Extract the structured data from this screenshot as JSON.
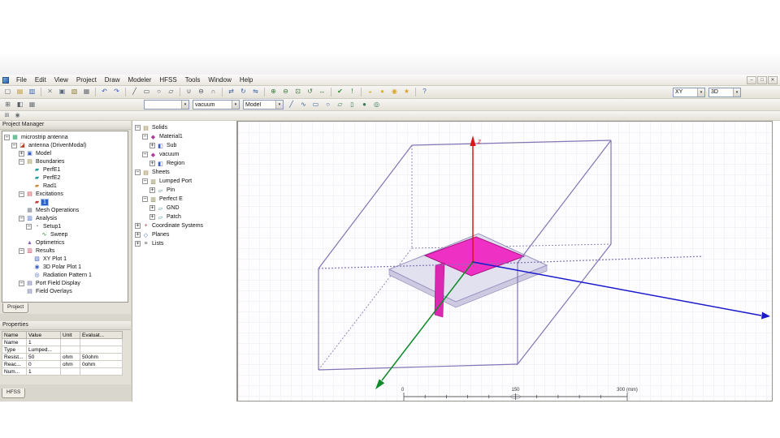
{
  "colors": {
    "selection": "#2b5fc7",
    "patch": "#ee30c5",
    "substrate": "#dfdeee",
    "box_edge": "#8474b4",
    "axis_x": "#1a1acc",
    "axis_y": "#0f8a28",
    "axis_z": "#e01414"
  },
  "app": {
    "menu_items": [
      "File",
      "Edit",
      "View",
      "Project",
      "Draw",
      "Modeler",
      "HFSS",
      "Tools",
      "Window",
      "Help"
    ],
    "window_controls": [
      {
        "n": "minimize-icon",
        "g": "–"
      },
      {
        "n": "restore-icon",
        "g": "□"
      },
      {
        "n": "close-icon",
        "g": "✕"
      }
    ]
  },
  "toolbars": {
    "combos": {
      "part": "",
      "material": "vacuum",
      "model": "Model",
      "plane": "XY",
      "view": "3D"
    },
    "main": [
      {
        "n": "new-file-icon",
        "g": "▢",
        "c": "#5a5f66"
      },
      {
        "n": "open-folder-icon",
        "g": "▤",
        "c": "#c2952c"
      },
      {
        "n": "save-icon",
        "g": "▥",
        "c": "#2f5fb0"
      },
      {
        "sep": true
      },
      {
        "n": "cut-icon",
        "g": "✕",
        "c": "#7a7f86"
      },
      {
        "n": "copy-icon",
        "g": "▣",
        "c": "#56677e"
      },
      {
        "n": "paste-icon",
        "g": "▧",
        "c": "#93803b"
      },
      {
        "n": "print-icon",
        "g": "▦",
        "c": "#6a6f76"
      },
      {
        "sep": true
      },
      {
        "n": "undo-icon",
        "g": "↶",
        "c": "#2c55c0"
      },
      {
        "n": "redo-icon",
        "g": "↷",
        "c": "#2c55c0"
      },
      {
        "sep": true
      },
      {
        "n": "draw-line-icon",
        "g": "╱",
        "c": "#4a4f56"
      },
      {
        "n": "draw-rectangle-icon",
        "g": "▭",
        "c": "#4a4f56"
      },
      {
        "n": "draw-circle-icon",
        "g": "○",
        "c": "#4a4f56"
      },
      {
        "n": "draw-box-icon",
        "g": "▱",
        "c": "#4a4f56"
      },
      {
        "sep": true
      },
      {
        "n": "boolean-unite-icon",
        "g": "∪",
        "c": "#50555c"
      },
      {
        "n": "boolean-subtract-icon",
        "g": "⊖",
        "c": "#50555c"
      },
      {
        "n": "boolean-intersect-icon",
        "g": "∩",
        "c": "#50555c"
      },
      {
        "sep": true
      },
      {
        "n": "move-icon",
        "g": "⇄",
        "c": "#39619e"
      },
      {
        "n": "rotate-object-icon",
        "g": "↻",
        "c": "#39619e"
      },
      {
        "n": "mirror-icon",
        "g": "⇋",
        "c": "#39619e"
      },
      {
        "sep": true
      },
      {
        "n": "zoom-in-icon",
        "g": "⊕",
        "c": "#3c7a3c"
      },
      {
        "n": "zoom-out-icon",
        "g": "⊖",
        "c": "#3c7a3c"
      },
      {
        "n": "fit-all-icon",
        "g": "⊡",
        "c": "#3c7a3c"
      },
      {
        "n": "rotate-view-icon",
        "g": "↺",
        "c": "#3c7a3c"
      },
      {
        "n": "pan-view-icon",
        "g": "↔",
        "c": "#3c7a3c"
      },
      {
        "sep": true
      },
      {
        "n": "validate-icon",
        "g": "✔",
        "c": "#2e8b2e"
      },
      {
        "n": "analyze-all-icon",
        "g": "!",
        "c": "#1f7a1f"
      },
      {
        "sep": true
      },
      {
        "n": "solution-data-icon",
        "g": "◒",
        "c": "#d9b42a"
      },
      {
        "n": "field-overlays-icon",
        "g": "●",
        "c": "#d9b42a"
      },
      {
        "n": "far-field-report-icon",
        "g": "◉",
        "c": "#d9a22a"
      },
      {
        "n": "optimetrics-results-icon",
        "g": "★",
        "c": "#d9a22a"
      },
      {
        "sep": true
      },
      {
        "n": "help-icon",
        "g": "?",
        "c": "#3a5fae"
      }
    ],
    "draw_left": [
      {
        "n": "grid-visibility-icon",
        "g": "⊞",
        "c": "#5a5f66"
      },
      {
        "n": "section-view-icon",
        "g": "◧",
        "c": "#5a5f66"
      },
      {
        "n": "measure-icon",
        "g": "▦",
        "c": "#6f747b"
      }
    ],
    "draw_right": [
      {
        "n": "polyline-tool-icon",
        "g": "╱",
        "c": "#39619e"
      },
      {
        "n": "spline-tool-icon",
        "g": "∿",
        "c": "#39619e"
      },
      {
        "n": "rectangle-tool-icon",
        "g": "▭",
        "c": "#39619e"
      },
      {
        "n": "ellipse-tool-icon",
        "g": "○",
        "c": "#39619e"
      },
      {
        "n": "box-tool-icon",
        "g": "▱",
        "c": "#3a7a5a"
      },
      {
        "n": "cylinder-tool-icon",
        "g": "▯",
        "c": "#3a7a5a"
      },
      {
        "n": "sphere-tool-icon",
        "g": "●",
        "c": "#3a7a5a"
      },
      {
        "n": "torus-tool-icon",
        "g": "◎",
        "c": "#3a7a5a"
      }
    ],
    "snap": [
      {
        "n": "snap-grid-icon",
        "g": "⊞",
        "c": "#666b72"
      },
      {
        "n": "snap-center-icon",
        "g": "◉",
        "c": "#666b72"
      }
    ]
  },
  "project_manager": {
    "title": "Project Manager",
    "tab": "Project",
    "items": [
      {
        "label": "microstrip antenna",
        "icon": "project-icon",
        "g": "▦",
        "c": "#1f9e62",
        "level": 0,
        "expand": "minus"
      },
      {
        "label": "antenna (DrivenModal)",
        "icon": "design-icon",
        "g": "◪",
        "c": "#c23a2a",
        "level": 1,
        "expand": "minus"
      },
      {
        "label": "Model",
        "icon": "model-icon",
        "g": "▣",
        "c": "#3a5fc0",
        "level": 2,
        "expand": "plus"
      },
      {
        "label": "Boundaries",
        "icon": "boundaries-icon",
        "g": "▤",
        "c": "#93803b",
        "level": 2,
        "expand": "minus"
      },
      {
        "label": "PerfE1",
        "icon": "perfe-boundary-icon",
        "g": "▰",
        "c": "#1f9e9e",
        "level": 3
      },
      {
        "label": "PerfE2",
        "icon": "perfe-boundary-icon",
        "g": "▰",
        "c": "#1f9e9e",
        "level": 3
      },
      {
        "label": "Rad1",
        "icon": "radiation-boundary-icon",
        "g": "▰",
        "c": "#d0883a",
        "level": 3
      },
      {
        "label": "Excitations",
        "icon": "excitations-icon",
        "g": "▤",
        "c": "#c23a3a",
        "level": 2,
        "expand": "minus"
      },
      {
        "label": "1",
        "icon": "port-icon",
        "g": "▰",
        "c": "#c23a3a",
        "level": 3,
        "selected": true
      },
      {
        "label": "Mesh Operations",
        "icon": "mesh-operations-icon",
        "g": "▦",
        "c": "#79808a",
        "level": 2
      },
      {
        "label": "Analysis",
        "icon": "analysis-icon",
        "g": "▥",
        "c": "#3a5fc0",
        "level": 2,
        "expand": "minus"
      },
      {
        "label": "Setup1",
        "icon": "setup-icon",
        "g": "◔",
        "c": "#6f747b",
        "level": 3,
        "expand": "minus"
      },
      {
        "label": "Sweep",
        "icon": "sweep-icon",
        "g": "∿",
        "c": "#2e8b2e",
        "level": 4
      },
      {
        "label": "Optimetrics",
        "icon": "optimetrics-icon",
        "g": "▲",
        "c": "#8a5fc0",
        "level": 2
      },
      {
        "label": "Results",
        "icon": "results-icon",
        "g": "▥",
        "c": "#c23a5a",
        "level": 2,
        "expand": "minus"
      },
      {
        "label": "XY Plot 1",
        "icon": "xy-plot-icon",
        "g": "▧",
        "c": "#3a5fc0",
        "level": 3
      },
      {
        "label": "3D Polar Plot 1",
        "icon": "polar-plot-icon",
        "g": "◉",
        "c": "#3a5fc0",
        "level": 3
      },
      {
        "label": "Radiation Pattern 1",
        "icon": "radiation-pattern-icon",
        "g": "◎",
        "c": "#3a5fc0",
        "level": 3
      },
      {
        "label": "Port Field Display",
        "icon": "port-field-display-icon",
        "g": "▤",
        "c": "#5a5f9e",
        "level": 2,
        "expand": "minus"
      },
      {
        "label": "Field Overlays",
        "icon": "field-overlays-icon",
        "g": "▤",
        "c": "#5a5f9e",
        "level": 2
      }
    ]
  },
  "model_tree": {
    "items": [
      {
        "label": "Solids",
        "icon": "solids-folder-icon",
        "g": "▤",
        "c": "#8a7a3a",
        "level": 0,
        "expand": "minus"
      },
      {
        "label": "Material1",
        "icon": "material-icon",
        "g": "◆",
        "c": "#b03a9a",
        "level": 1,
        "expand": "minus"
      },
      {
        "label": "Sub",
        "icon": "solid-object-icon",
        "g": "◧",
        "c": "#3a5fc0",
        "level": 2,
        "expand": "plus"
      },
      {
        "label": "vacuum",
        "icon": "material-icon",
        "g": "◆",
        "c": "#b03a9a",
        "level": 1,
        "expand": "minus"
      },
      {
        "label": "Region",
        "icon": "solid-object-icon",
        "g": "◧",
        "c": "#3a5fc0",
        "level": 2,
        "expand": "plus"
      },
      {
        "label": "Sheets",
        "icon": "sheets-folder-icon",
        "g": "▤",
        "c": "#8a7a3a",
        "level": 0,
        "expand": "minus"
      },
      {
        "label": "Lumped Port",
        "icon": "boundary-group-icon",
        "g": "▥",
        "c": "#7a7a3a",
        "level": 1,
        "expand": "minus"
      },
      {
        "label": "Pin",
        "icon": "sheet-object-icon",
        "g": "▱",
        "c": "#3a8a8a",
        "level": 2,
        "expand": "plus"
      },
      {
        "label": "Perfect E",
        "icon": "boundary-group-icon",
        "g": "▥",
        "c": "#7a7a3a",
        "level": 1,
        "expand": "minus"
      },
      {
        "label": "GND",
        "icon": "sheet-object-icon",
        "g": "▱",
        "c": "#3a8a8a",
        "level": 2,
        "expand": "plus"
      },
      {
        "label": "Patch",
        "icon": "sheet-object-icon",
        "g": "▱",
        "c": "#3a8a8a",
        "level": 2,
        "expand": "plus"
      },
      {
        "label": "Coordinate Systems",
        "icon": "coordinate-systems-icon",
        "g": "+",
        "c": "#b03a3a",
        "level": 0,
        "expand": "plus"
      },
      {
        "label": "Planes",
        "icon": "planes-icon",
        "g": "◇",
        "c": "#3a5fc0",
        "level": 0,
        "expand": "plus"
      },
      {
        "label": "Lists",
        "icon": "lists-icon",
        "g": "≡",
        "c": "#5a5f66",
        "level": 0,
        "expand": "plus"
      }
    ]
  },
  "properties": {
    "title": "Properties",
    "columns": [
      "Name",
      "Value",
      "Unit",
      "Evaluat..."
    ],
    "rows": [
      [
        "Name",
        "1",
        "",
        ""
      ],
      [
        "Type",
        "Lumped...",
        "",
        ""
      ],
      [
        "Resist...",
        "50",
        "ohm",
        "50ohm"
      ],
      [
        "Reac...",
        "0",
        "ohm",
        "0ohm"
      ],
      [
        "Num...",
        "1",
        "",
        ""
      ]
    ],
    "bottom_tab": "HFSS"
  },
  "viewport": {
    "axis_labels": {
      "z": "z"
    },
    "ruler": {
      "zero": "0",
      "mid": "150",
      "end": "300 (mm)"
    }
  }
}
